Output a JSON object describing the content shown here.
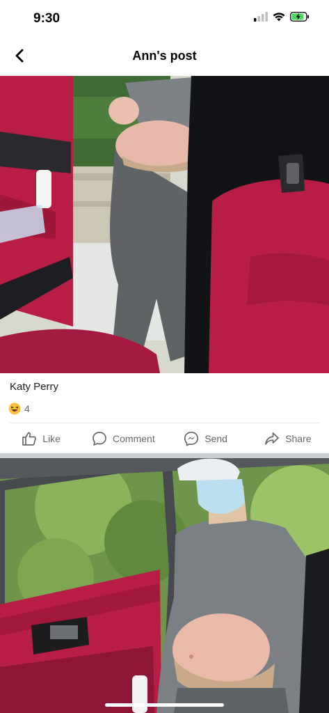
{
  "status": {
    "time": "9:30"
  },
  "header": {
    "title": "Ann's post"
  },
  "post": {
    "author": "Katy Perry",
    "reaction_count": "4",
    "actions": {
      "like": "Like",
      "comment": "Comment",
      "send": "Send",
      "share": "Share"
    }
  },
  "icons": {
    "back": "chevron-left-icon",
    "reaction": "laughing-emoji-icon",
    "like": "thumbs-up-icon",
    "comment": "comment-bubble-icon",
    "send": "messenger-icon",
    "share": "share-arrow-icon"
  },
  "colors": {
    "accent_text": "#65676b",
    "car_interior": "#b81e45",
    "battery": "#4cd964"
  }
}
